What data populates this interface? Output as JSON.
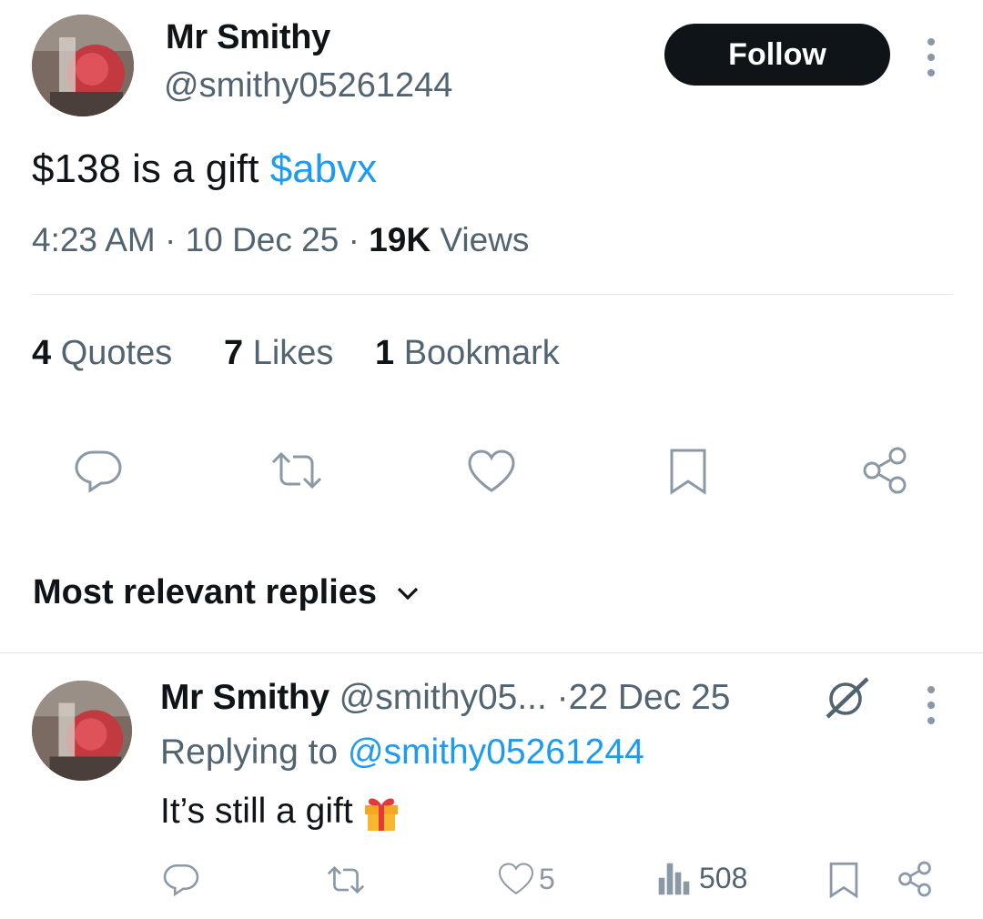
{
  "tweet": {
    "author_name": "Mr Smithy",
    "author_handle": "@smithy05261244",
    "follow_label": "Follow",
    "text_plain": "$138 is a gift ",
    "text_cashtag": "$abvx",
    "time": "4:23 AM",
    "sep1": "·",
    "date": "10 Dec 25",
    "sep2": "·",
    "views_count": "19K",
    "views_label": "Views"
  },
  "stats": {
    "quotes_count": "4",
    "quotes_label": "Quotes",
    "likes_count": "7",
    "likes_label": "Likes",
    "bookmarks_count": "1",
    "bookmarks_label": "Bookmark"
  },
  "sort": {
    "label": "Most relevant replies"
  },
  "reply": {
    "author_name": "Mr Smithy",
    "author_handle": "@smithy05...",
    "sep": "·",
    "date": "22 Dec 25",
    "replying_to_label": "Replying to",
    "replying_to_handle": "@smithy05261244",
    "text": "It’s still a gift",
    "likes": "5",
    "views": "508"
  },
  "icons": {
    "reply": "reply-icon",
    "retweet": "retweet-icon",
    "like": "heart-icon",
    "bookmark": "bookmark-icon",
    "share": "share-icon",
    "views": "views-icon",
    "grok": "grok-icon",
    "gift": "gift-icon",
    "more": "more-icon",
    "chevron": "chevron-down-icon"
  },
  "colors": {
    "text": "#0f1419",
    "muted": "#536471",
    "link": "#1d9bf0",
    "icon": "#8b98a5",
    "button": "#0f1419"
  }
}
